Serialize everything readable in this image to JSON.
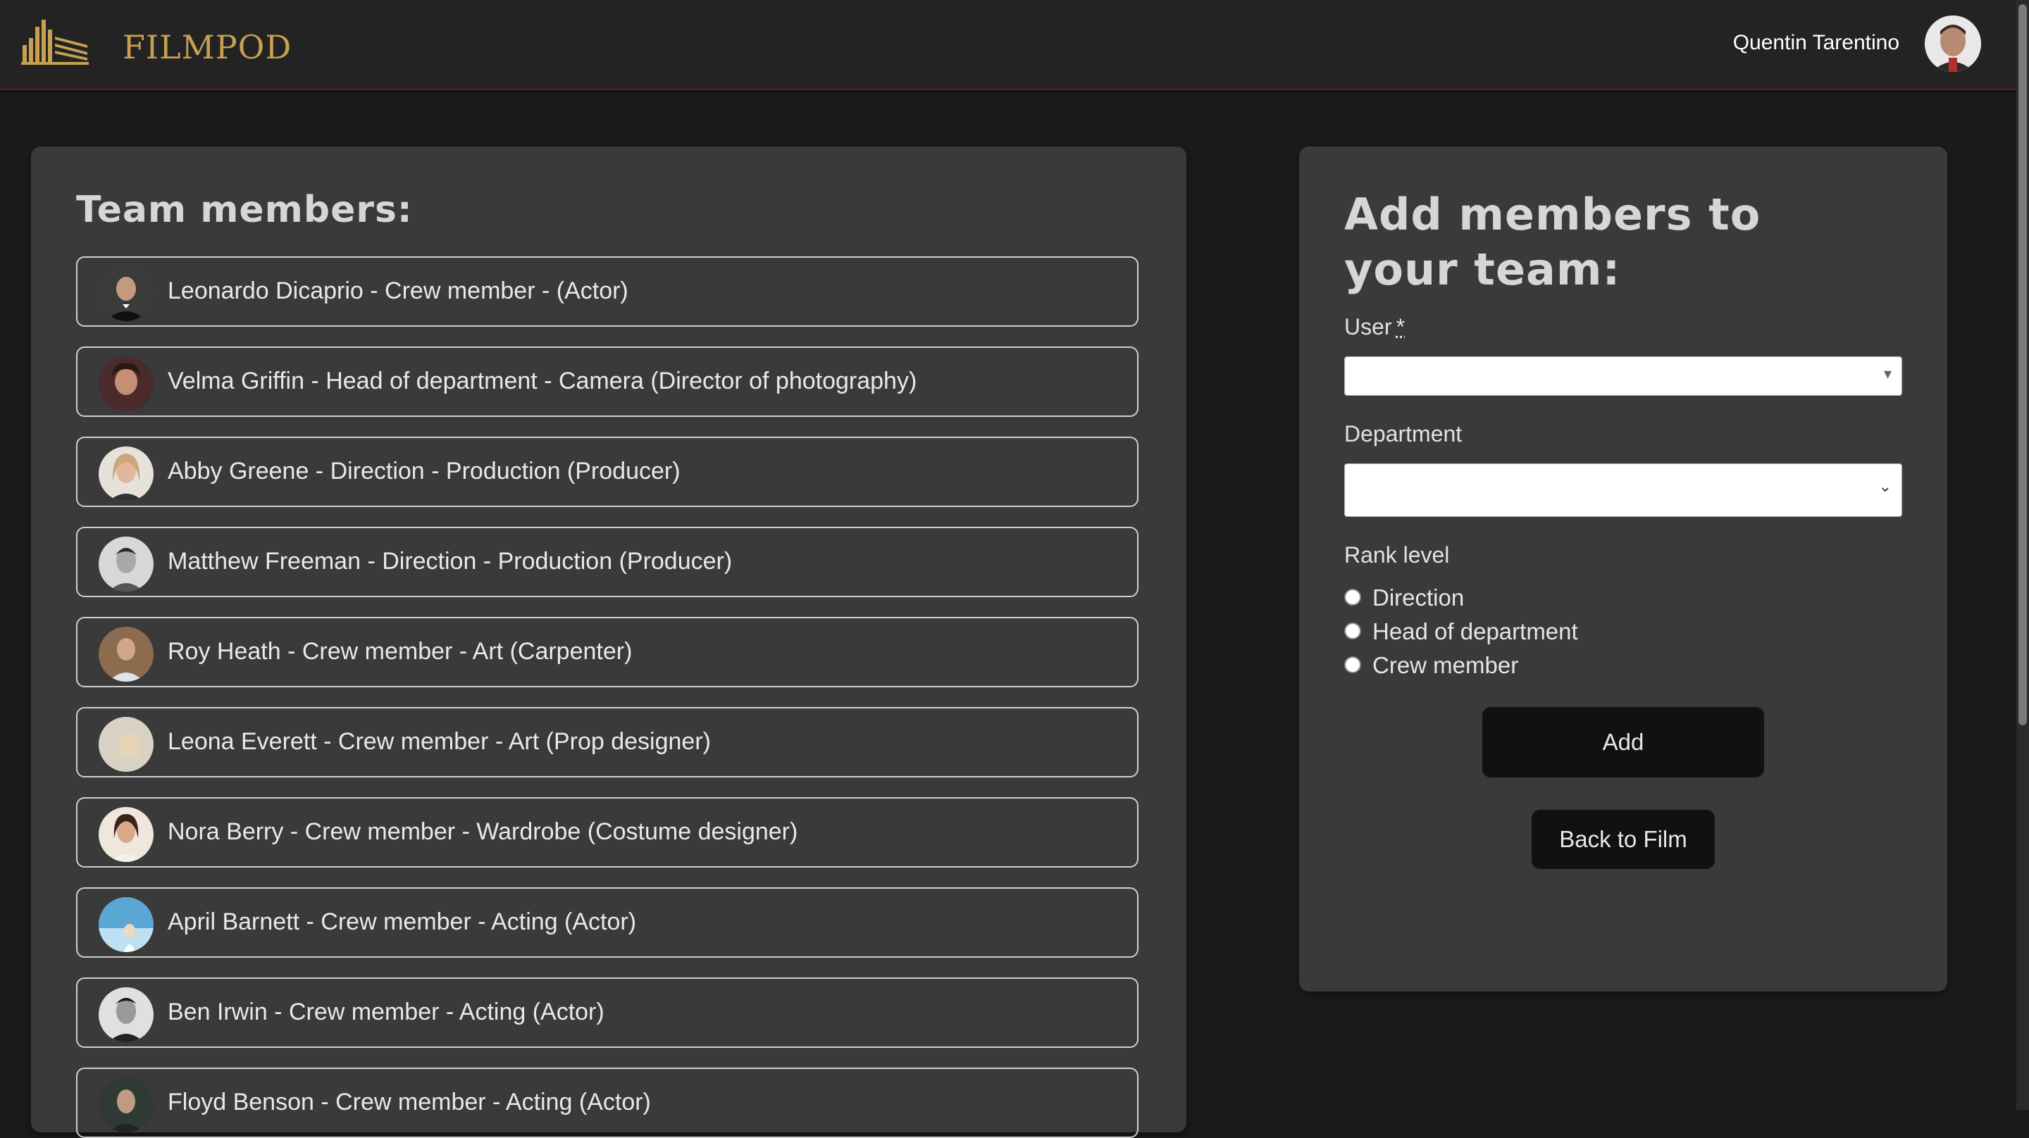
{
  "brand": {
    "name": "FILMPOD",
    "accent": "#c8a052"
  },
  "user": {
    "name": "Quentin Tarentino"
  },
  "team": {
    "title": "Team members:",
    "members": [
      {
        "text": "Leonardo Dicaprio - Crew member - (Actor)",
        "avatar_color": "#3b3b3b"
      },
      {
        "text": "Velma Griffin - Head of department - Camera (Director of photography)",
        "avatar_color": "#4a2a2a"
      },
      {
        "text": "Abby Greene - Direction - Production (Producer)",
        "avatar_color": "#c9a77c"
      },
      {
        "text": "Matthew Freeman - Direction - Production (Producer)",
        "avatar_color": "#bdbdbd"
      },
      {
        "text": "Roy Heath - Crew member - Art (Carpenter)",
        "avatar_color": "#8c6b4e"
      },
      {
        "text": "Leona Everett - Crew member - Art (Prop designer)",
        "avatar_color": "#d9d2c4"
      },
      {
        "text": "Nora Berry - Crew member - Wardrobe (Costume designer)",
        "avatar_color": "#e0cfc0"
      },
      {
        "text": "April Barnett - Crew member - Acting (Actor)",
        "avatar_color": "#5aa7d6"
      },
      {
        "text": "Ben Irwin - Crew member - Acting (Actor)",
        "avatar_color": "#d0d0d0"
      },
      {
        "text": "Floyd Benson - Crew member - Acting (Actor)",
        "avatar_color": "#2f3a35"
      }
    ]
  },
  "form": {
    "title": "Add members to your team:",
    "user_label": "User",
    "required_mark": "*",
    "department_label": "Department",
    "rank_label": "Rank level",
    "rank_options": [
      "Direction",
      "Head of department",
      "Crew member"
    ],
    "add_button": "Add",
    "back_button": "Back to Film"
  }
}
